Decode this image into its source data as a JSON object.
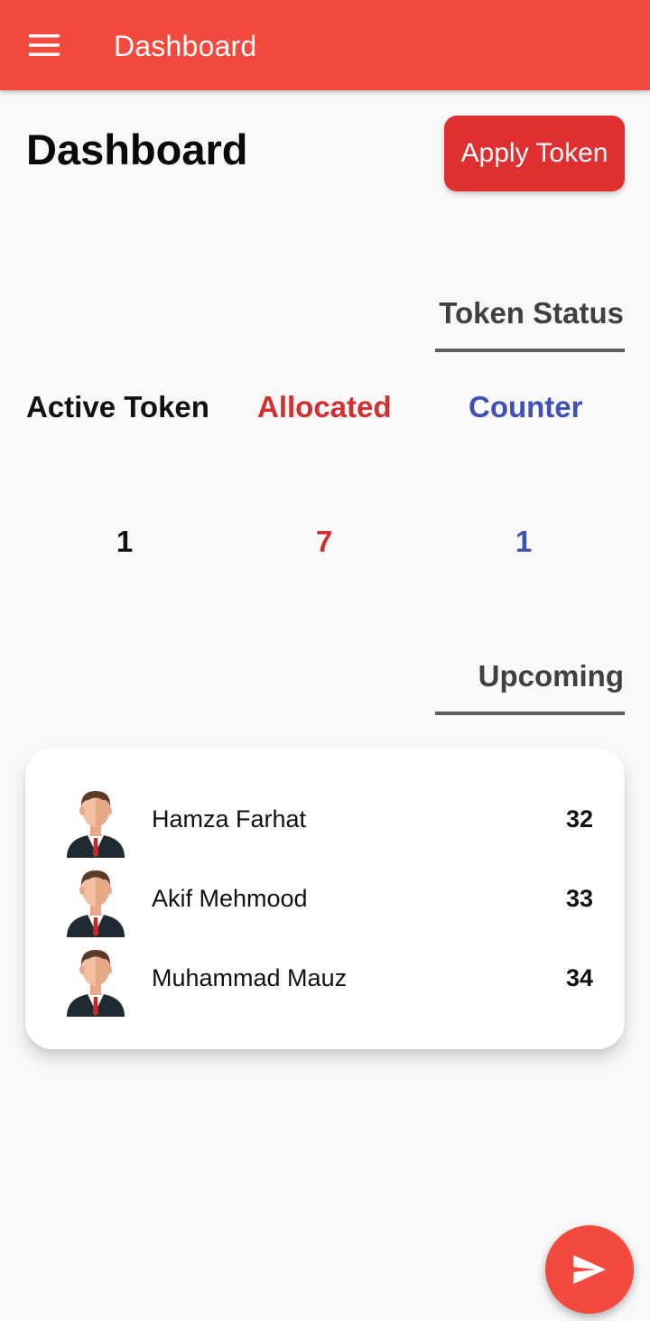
{
  "appbar": {
    "title": "Dashboard",
    "menu_icon": "hamburger-menu-icon",
    "background": "#f44a3e"
  },
  "page": {
    "title": "Dashboard",
    "apply_button_label": "Apply Token"
  },
  "token_status": {
    "heading": "Token Status",
    "stats": [
      {
        "label": "Active Token",
        "value": "1",
        "color": "#111111"
      },
      {
        "label": "Allocated",
        "value": "7",
        "color": "#d32f2f"
      },
      {
        "label": "Counter",
        "value": "1",
        "color": "#3f51b5"
      }
    ]
  },
  "upcoming": {
    "heading": "Upcoming",
    "items": [
      {
        "name": "Hamza Farhat",
        "token": "32"
      },
      {
        "name": "Akif Mehmood",
        "token": "33"
      },
      {
        "name": "Muhammad Mauz",
        "token": "34"
      }
    ]
  },
  "fab": {
    "icon": "send-icon",
    "color": "#f44a3e"
  }
}
